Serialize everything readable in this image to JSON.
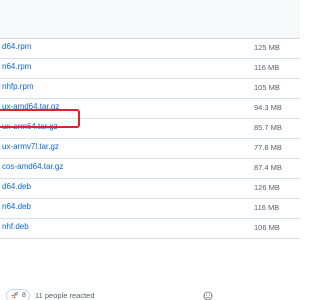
{
  "assets": [
    {
      "name": "d64.rpm",
      "size": "125 MB"
    },
    {
      "name": "n64.rpm",
      "size": "116 MB"
    },
    {
      "name": "nhfp.rpm",
      "size": "105 MB"
    },
    {
      "name": "ux-amd64.tar.gz",
      "size": "94.3 MB",
      "highlighted": true
    },
    {
      "name": "ux-arm64.tar.gz",
      "size": "85.7 MB"
    },
    {
      "name": "ux-armv7l.tar.gz",
      "size": "77.8 MB"
    },
    {
      "name": "cos-amd64.tar.gz",
      "size": "87.4 MB"
    },
    {
      "name": "d64.deb",
      "size": "126 MB"
    },
    {
      "name": "n64.deb",
      "size": "116 MB"
    },
    {
      "name": "nhf.deb",
      "size": "106 MB"
    }
  ],
  "reactions": {
    "emoji_icon": "rocket-icon",
    "count": "8",
    "summary": "11 people reacted"
  },
  "colors": {
    "link": "#0969da",
    "muted": "#57606a",
    "highlight": "#e0242d"
  }
}
